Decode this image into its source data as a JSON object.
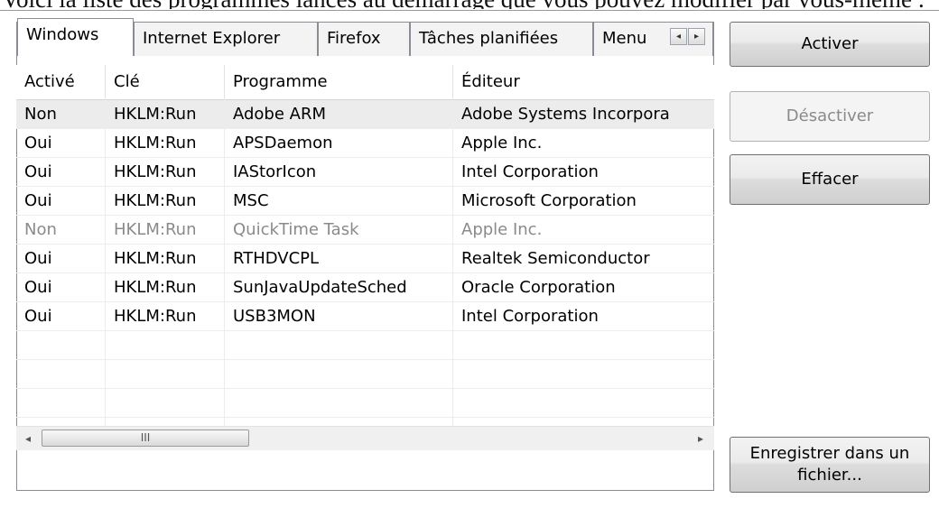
{
  "top_text": "Voici la liste des programmes lancés au démarrage que vous pouvez modifier par vous-même :",
  "tabs": [
    {
      "label": "Windows",
      "active": true
    },
    {
      "label": "Internet Explorer",
      "active": false
    },
    {
      "label": "Firefox",
      "active": false
    },
    {
      "label": "Tâches planifiées",
      "active": false
    },
    {
      "label": "Menu",
      "active": false
    }
  ],
  "tab_scroll": {
    "left_glyph": "◂",
    "right_glyph": "▸"
  },
  "columns": [
    "Activé",
    "Clé",
    "Programme",
    "Éditeur"
  ],
  "rows": [
    {
      "enabled": "Non",
      "key": "HKLM:Run",
      "program": "Adobe ARM",
      "publisher": "Adobe Systems Incorpora",
      "selected": true,
      "disabled": false
    },
    {
      "enabled": "Oui",
      "key": "HKLM:Run",
      "program": "APSDaemon",
      "publisher": "Apple Inc.",
      "selected": false,
      "disabled": false
    },
    {
      "enabled": "Oui",
      "key": "HKLM:Run",
      "program": "IAStorIcon",
      "publisher": "Intel Corporation",
      "selected": false,
      "disabled": false
    },
    {
      "enabled": "Oui",
      "key": "HKLM:Run",
      "program": "MSC",
      "publisher": "Microsoft Corporation",
      "selected": false,
      "disabled": false
    },
    {
      "enabled": "Non",
      "key": "HKLM:Run",
      "program": "QuickTime Task",
      "publisher": "Apple Inc.",
      "selected": false,
      "disabled": true
    },
    {
      "enabled": "Oui",
      "key": "HKLM:Run",
      "program": "RTHDVCPL",
      "publisher": "Realtek Semiconductor",
      "selected": false,
      "disabled": false
    },
    {
      "enabled": "Oui",
      "key": "HKLM:Run",
      "program": "SunJavaUpdateSched",
      "publisher": "Oracle Corporation",
      "selected": false,
      "disabled": false
    },
    {
      "enabled": "Oui",
      "key": "HKLM:Run",
      "program": "USB3MON",
      "publisher": "Intel Corporation",
      "selected": false,
      "disabled": false
    }
  ],
  "hscroll": {
    "left_glyph": "◂",
    "right_glyph": "▸",
    "thumb_glyph": "III"
  },
  "buttons": {
    "activate": "Activer",
    "deactivate": "Désactiver",
    "clear": "Effacer",
    "save_line1": "Enregistrer dans un",
    "save_line2": "fichier..."
  },
  "colors": {
    "disabled_text": "#8a8a8a",
    "selected_row": "#ececec"
  }
}
